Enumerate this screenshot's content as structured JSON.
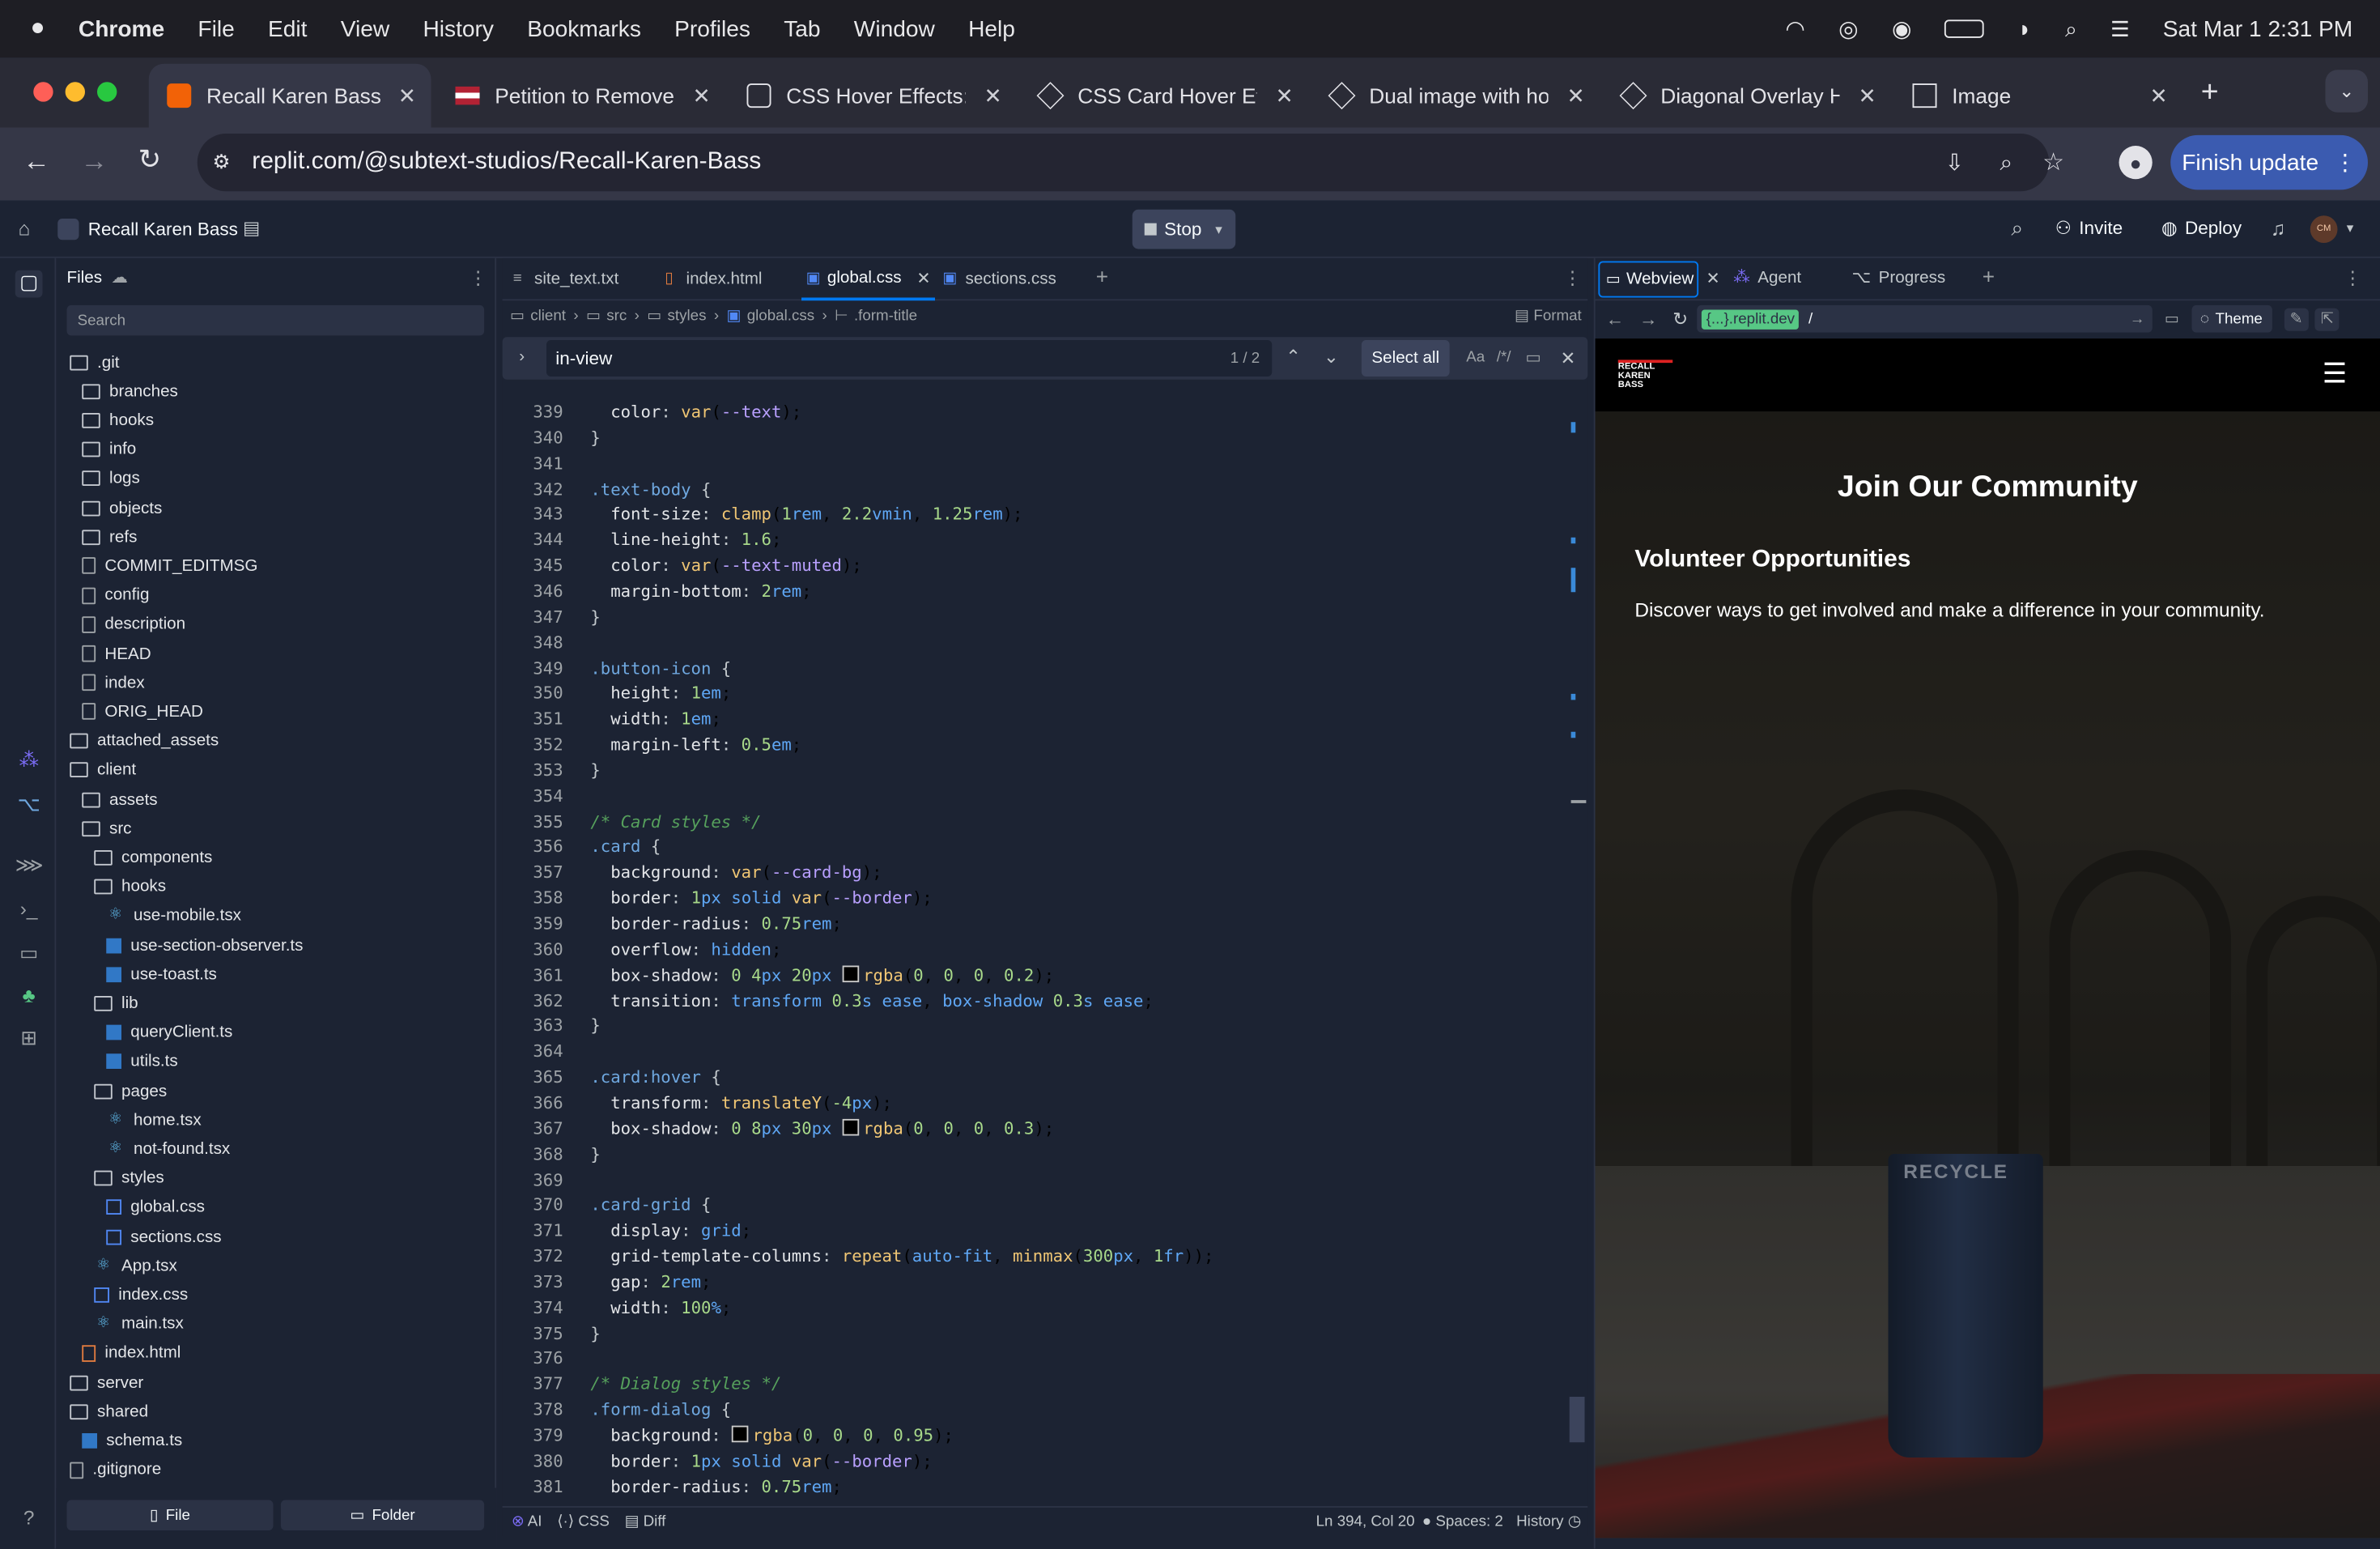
{
  "menubar": {
    "app": "Chrome",
    "items": [
      "File",
      "Edit",
      "View",
      "History",
      "Bookmarks",
      "Profiles",
      "Tab",
      "Window",
      "Help"
    ],
    "datetime": "Sat Mar 1  2:31 PM"
  },
  "browser": {
    "tabs": [
      {
        "title": "Recall Karen Bass -"
      },
      {
        "title": "Petition to Remove"
      },
      {
        "title": "CSS Hover Effects:"
      },
      {
        "title": "CSS Card Hover Eff"
      },
      {
        "title": "Dual image with ho"
      },
      {
        "title": "Diagonal Overlay H"
      },
      {
        "title": "Image"
      }
    ],
    "url": "replit.com/@subtext-studios/Recall-Karen-Bass",
    "finish_update": "Finish update"
  },
  "replit": {
    "project": "Recall Karen Bass",
    "stop": "Stop",
    "invite": "Invite",
    "deploy": "Deploy",
    "avatar": "CM"
  },
  "files": {
    "title": "Files",
    "search_placeholder": "Search",
    "tree": [
      {
        "name": ".git",
        "type": "folder",
        "depth": 0
      },
      {
        "name": "branches",
        "type": "folder",
        "depth": 1
      },
      {
        "name": "hooks",
        "type": "folder",
        "depth": 1
      },
      {
        "name": "info",
        "type": "folder",
        "depth": 1
      },
      {
        "name": "logs",
        "type": "folder",
        "depth": 1
      },
      {
        "name": "objects",
        "type": "folder",
        "depth": 1
      },
      {
        "name": "refs",
        "type": "folder",
        "depth": 1
      },
      {
        "name": "COMMIT_EDITMSG",
        "type": "file",
        "depth": 1
      },
      {
        "name": "config",
        "type": "file",
        "depth": 1
      },
      {
        "name": "description",
        "type": "file",
        "depth": 1
      },
      {
        "name": "HEAD",
        "type": "file",
        "depth": 1
      },
      {
        "name": "index",
        "type": "file",
        "depth": 1
      },
      {
        "name": "ORIG_HEAD",
        "type": "file",
        "depth": 1
      },
      {
        "name": "attached_assets",
        "type": "folder",
        "depth": 0
      },
      {
        "name": "client",
        "type": "folder",
        "depth": 0
      },
      {
        "name": "assets",
        "type": "folder",
        "depth": 1
      },
      {
        "name": "src",
        "type": "folder",
        "depth": 1
      },
      {
        "name": "components",
        "type": "folder",
        "depth": 2
      },
      {
        "name": "hooks",
        "type": "folder",
        "depth": 2
      },
      {
        "name": "use-mobile.tsx",
        "type": "react",
        "depth": 3
      },
      {
        "name": "use-section-observer.ts",
        "type": "ts",
        "depth": 3
      },
      {
        "name": "use-toast.ts",
        "type": "ts",
        "depth": 3
      },
      {
        "name": "lib",
        "type": "folder",
        "depth": 2
      },
      {
        "name": "queryClient.ts",
        "type": "ts",
        "depth": 3
      },
      {
        "name": "utils.ts",
        "type": "ts",
        "depth": 3
      },
      {
        "name": "pages",
        "type": "folder",
        "depth": 2
      },
      {
        "name": "home.tsx",
        "type": "react",
        "depth": 3
      },
      {
        "name": "not-found.tsx",
        "type": "react",
        "depth": 3
      },
      {
        "name": "styles",
        "type": "folder",
        "depth": 2
      },
      {
        "name": "global.css",
        "type": "css",
        "depth": 3
      },
      {
        "name": "sections.css",
        "type": "css",
        "depth": 3
      },
      {
        "name": "App.tsx",
        "type": "react",
        "depth": 2
      },
      {
        "name": "index.css",
        "type": "css",
        "depth": 2
      },
      {
        "name": "main.tsx",
        "type": "react",
        "depth": 2
      },
      {
        "name": "index.html",
        "type": "html",
        "depth": 1
      },
      {
        "name": "server",
        "type": "folder",
        "depth": 0
      },
      {
        "name": "shared",
        "type": "folder",
        "depth": 0
      },
      {
        "name": "schema.ts",
        "type": "ts",
        "depth": 1
      },
      {
        "name": ".gitignore",
        "type": "file",
        "depth": 0
      }
    ],
    "new_file": "File",
    "new_folder": "Folder"
  },
  "editor": {
    "tabs": [
      "site_text.txt",
      "index.html",
      "global.css",
      "sections.css"
    ],
    "active_tab": "global.css",
    "breadcrumb": [
      "client",
      "src",
      "styles",
      "global.css",
      ".form-title"
    ],
    "format": "Format",
    "find": {
      "query": "in-view",
      "count": "1 / 2",
      "select_all": "Select all",
      "case": "Aa",
      "regex": "/*/"
    },
    "lines": [
      {
        "n": "339",
        "t": "  color: var(--text);"
      },
      {
        "n": "340",
        "t": "}"
      },
      {
        "n": "341",
        "t": ""
      },
      {
        "n": "342",
        "t": ".text-body {"
      },
      {
        "n": "343",
        "t": "  font-size: clamp(1rem, 2.2vmin, 1.25rem);"
      },
      {
        "n": "344",
        "t": "  line-height: 1.6;"
      },
      {
        "n": "345",
        "t": "  color: var(--text-muted);"
      },
      {
        "n": "346",
        "t": "  margin-bottom: 2rem;"
      },
      {
        "n": "347",
        "t": "}"
      },
      {
        "n": "348",
        "t": ""
      },
      {
        "n": "349",
        "t": ".button-icon {"
      },
      {
        "n": "350",
        "t": "  height: 1em;"
      },
      {
        "n": "351",
        "t": "  width: 1em;"
      },
      {
        "n": "352",
        "t": "  margin-left: 0.5em;"
      },
      {
        "n": "353",
        "t": "}"
      },
      {
        "n": "354",
        "t": ""
      },
      {
        "n": "355",
        "t": "/* Card styles */"
      },
      {
        "n": "356",
        "t": ".card {"
      },
      {
        "n": "357",
        "t": "  background: var(--card-bg);"
      },
      {
        "n": "358",
        "t": "  border: 1px solid var(--border);"
      },
      {
        "n": "359",
        "t": "  border-radius: 0.75rem;"
      },
      {
        "n": "360",
        "t": "  overflow: hidden;"
      },
      {
        "n": "361",
        "t": "  box-shadow: 0 4px 20px #rgba(0, 0, 0, 0.2);"
      },
      {
        "n": "362",
        "t": "  transition: transform 0.3s ease, box-shadow 0.3s ease;"
      },
      {
        "n": "363",
        "t": "}"
      },
      {
        "n": "364",
        "t": ""
      },
      {
        "n": "365",
        "t": ".card:hover {"
      },
      {
        "n": "366",
        "t": "  transform: translateY(-4px);"
      },
      {
        "n": "367",
        "t": "  box-shadow: 0 8px 30px #rgba(0, 0, 0, 0.3);"
      },
      {
        "n": "368",
        "t": "}"
      },
      {
        "n": "369",
        "t": ""
      },
      {
        "n": "370",
        "t": ".card-grid {"
      },
      {
        "n": "371",
        "t": "  display: grid;"
      },
      {
        "n": "372",
        "t": "  grid-template-columns: repeat(auto-fit, minmax(300px, 1fr));"
      },
      {
        "n": "373",
        "t": "  gap: 2rem;"
      },
      {
        "n": "374",
        "t": "  width: 100%;"
      },
      {
        "n": "375",
        "t": "}"
      },
      {
        "n": "376",
        "t": ""
      },
      {
        "n": "377",
        "t": "/* Dialog styles */"
      },
      {
        "n": "378",
        "t": ".form-dialog {"
      },
      {
        "n": "379",
        "t": "  background: #rgba(0, 0, 0, 0.95);"
      },
      {
        "n": "380",
        "t": "  border: 1px solid var(--border);"
      },
      {
        "n": "381",
        "t": "  border-radius: 0.75rem;"
      }
    ],
    "status": {
      "ai": "AI",
      "lang": "CSS",
      "diff": "Diff",
      "position": "Ln 394, Col 20",
      "spaces": "Spaces: 2",
      "history": "History"
    }
  },
  "webview": {
    "tabs": [
      "Webview",
      "Agent",
      "Progress"
    ],
    "url_host": "{...}.replit.dev",
    "url_path": "/",
    "theme": "Theme",
    "logo": "RECALL KAREN BASS",
    "heading": "Join Our Community",
    "subheading": "Volunteer Opportunities",
    "body": "Discover ways to get involved and make a difference in your community.",
    "bin_text": "RECYCLE"
  }
}
